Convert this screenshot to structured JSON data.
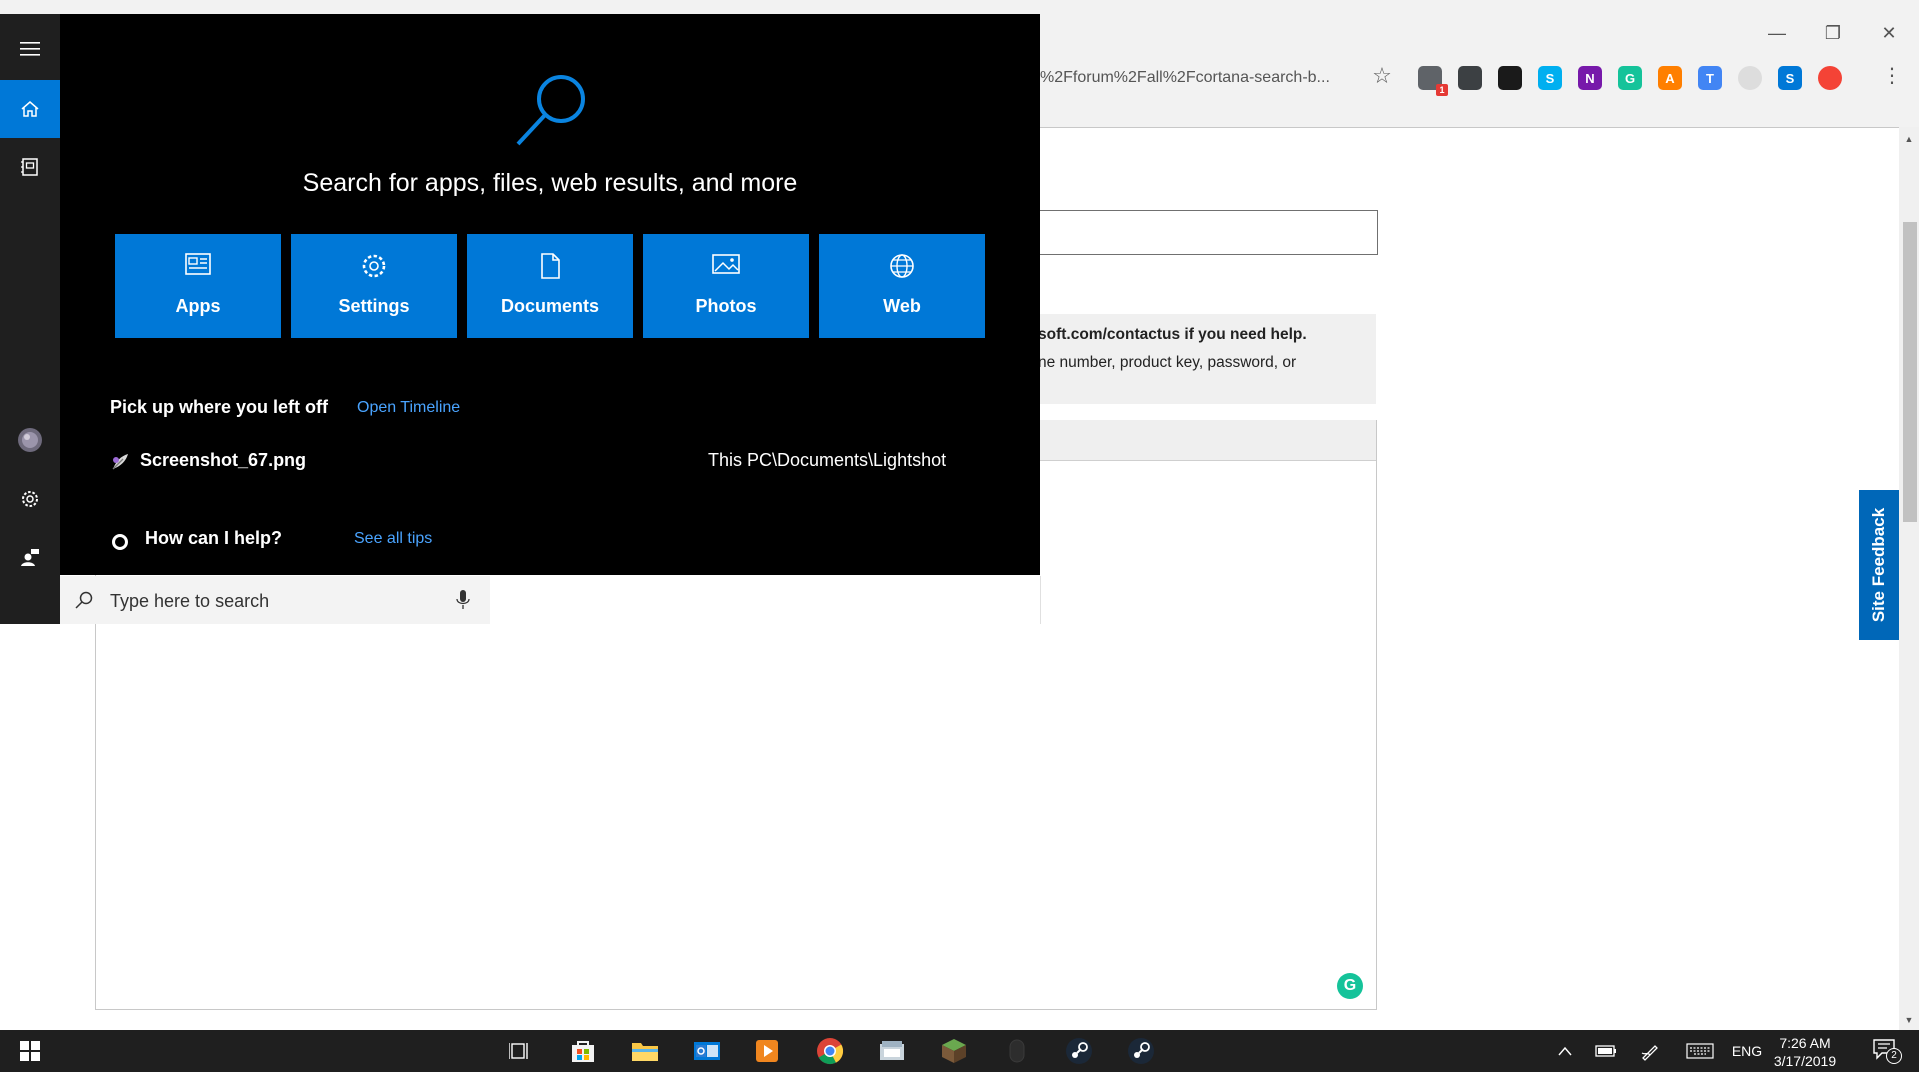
{
  "browser": {
    "address_text": "%2Fforum%2Fall%2Fcortana-search-b...",
    "extensions": [
      {
        "icon": "password-manager-icon",
        "color": "#5f6368",
        "badge": "1"
      },
      {
        "icon": "location-pin-icon",
        "color": "#3c4043"
      },
      {
        "icon": "shield-icon",
        "color": "#1a1a1a"
      },
      {
        "icon": "skype-icon",
        "color": "#00aff0",
        "glyph": "S"
      },
      {
        "icon": "onenote-icon",
        "color": "#7719aa",
        "glyph": "N"
      },
      {
        "icon": "grammarly-icon",
        "color": "#15c39a",
        "glyph": "G"
      },
      {
        "icon": "accessibility-icon",
        "color": "#ff7f00",
        "glyph": "A"
      },
      {
        "icon": "translate-icon",
        "color": "#4285f4",
        "glyph": "T"
      },
      {
        "icon": "ghost-icon",
        "color": "#dddddd"
      },
      {
        "icon": "sway-icon",
        "color": "#0078d7",
        "glyph": "S"
      },
      {
        "icon": "profile-avatar-icon",
        "color": "#f44336"
      }
    ]
  },
  "page": {
    "help_line1": "soft.com/contactus if you need help.",
    "help_line2": "ne number, product key, password, or",
    "feedback_label": "Site Feedback"
  },
  "cortana": {
    "hero_title": "Search for apps, files, web results, and more",
    "tiles": [
      {
        "label": "Apps",
        "icon": "apps-icon"
      },
      {
        "label": "Settings",
        "icon": "settings-icon"
      },
      {
        "label": "Documents",
        "icon": "documents-icon"
      },
      {
        "label": "Photos",
        "icon": "photos-icon"
      },
      {
        "label": "Web",
        "icon": "web-globe-icon"
      }
    ],
    "pickup_title": "Pick up where you left off",
    "timeline_link": "Open Timeline",
    "recent_name": "Screenshot_67.png",
    "recent_path": "This PC\\Documents\\Lightshot",
    "help_question": "How can I help?",
    "tips_link": "See all tips",
    "search_placeholder": "Type here to search"
  },
  "taskbar": {
    "lang": "ENG",
    "time": "7:26 AM",
    "date": "3/17/2019",
    "notification_count": "2"
  }
}
